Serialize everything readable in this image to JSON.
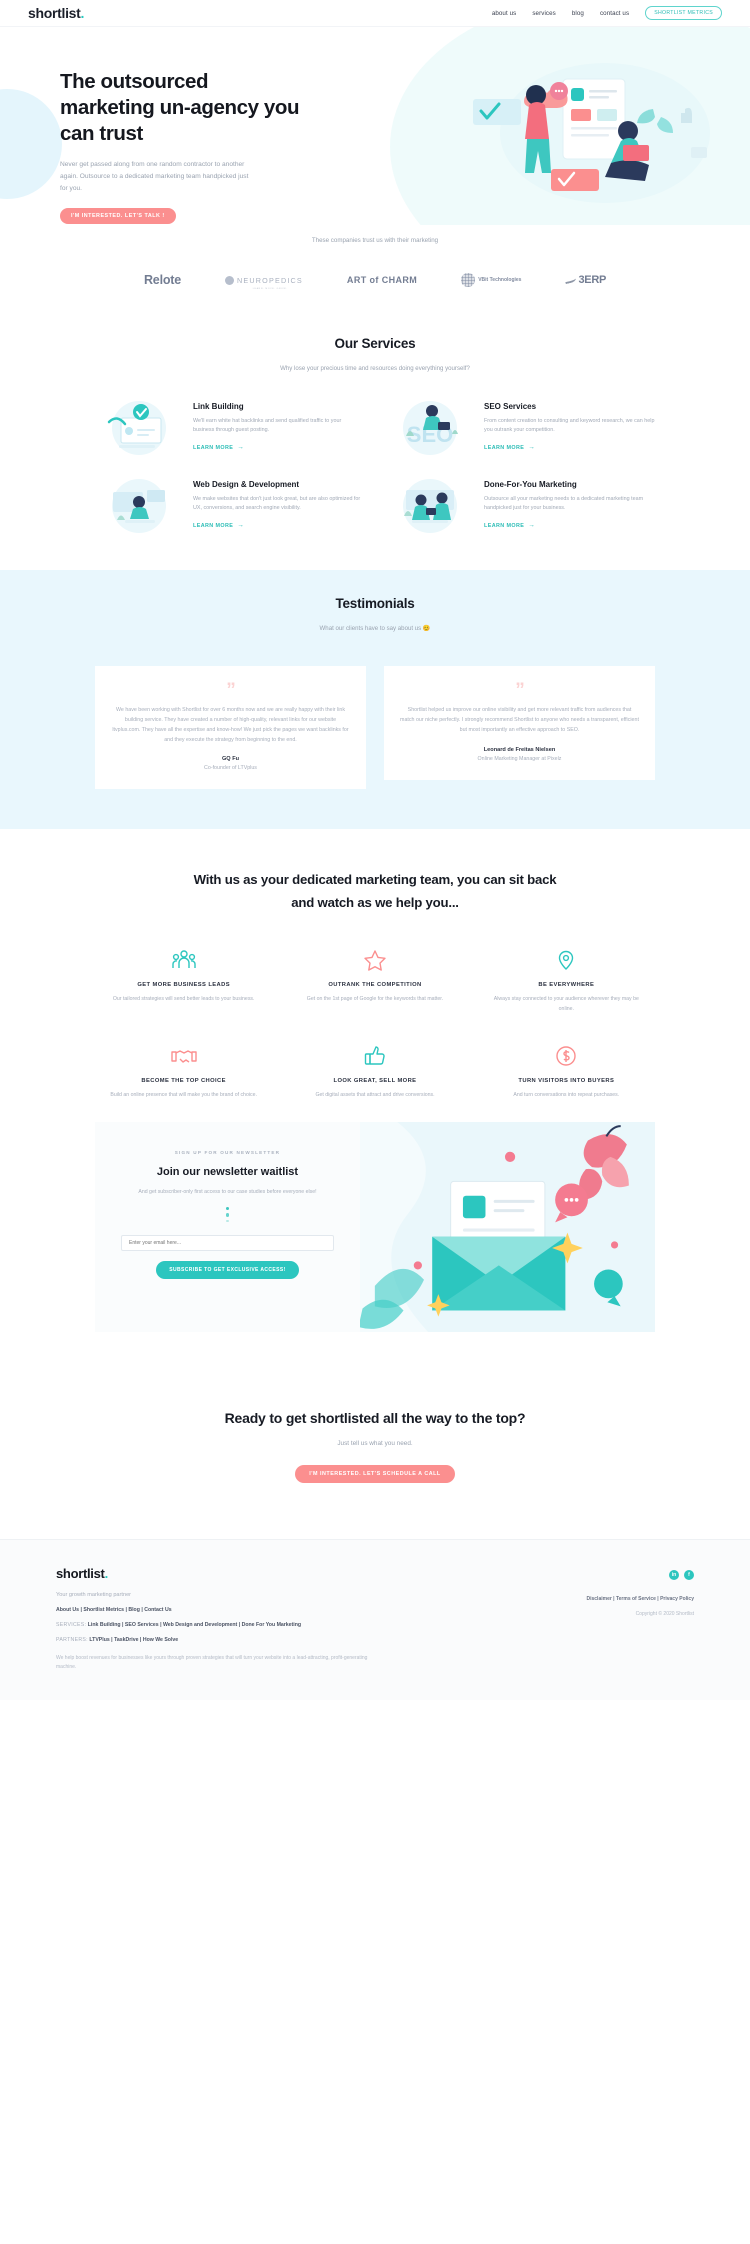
{
  "nav": {
    "logo": "shortlist",
    "logo_dot": ".",
    "links": [
      {
        "label": "about us"
      },
      {
        "label": "services"
      },
      {
        "label": "blog"
      },
      {
        "label": "contact us"
      }
    ],
    "cta_pill": "SHORTLIST METRICS"
  },
  "hero": {
    "heading": "The outsourced marketing un-agency you can trust",
    "paragraph": "Never get passed along from one random contractor to another again. Outsource to a dedicated marketing team handpicked just for you.",
    "button": "I'M INTERESTED. LET'S TALK !"
  },
  "trust": {
    "label": "These companies trust us with their marketing",
    "logos": [
      {
        "name": "Relote"
      },
      {
        "name": "NEUROPEDICS",
        "sub": "LEARN. MOVE. GROW."
      },
      {
        "name": "ART of CHARM"
      },
      {
        "name": "VBit Technologies"
      },
      {
        "name": "3ERP"
      }
    ]
  },
  "services": {
    "title": "Our Services",
    "subtitle": "Why lose your precious time and resources doing everything yourself?",
    "learn_more": "LEARN MORE",
    "items": [
      {
        "title": "Link Building",
        "desc": "We'll earn white hat backlinks and send qualified traffic to your business through guest posting."
      },
      {
        "title": "SEO Services",
        "desc": "From content creation to consulting and keyword research, we can help you outrank your competition."
      },
      {
        "title": "Web Design & Development",
        "desc": "We make websites that don't just look great, but are also optimized for UX, conversions, and search engine visibility."
      },
      {
        "title": "Done-For-You Marketing",
        "desc": "Outsource all your marketing needs to a dedicated marketing team handpicked just for your business."
      }
    ]
  },
  "testimonials": {
    "title": "Testimonials",
    "subtitle": "What our clients have to say about us 😊",
    "items": [
      {
        "quote": "We have been working with Shortlist for over 6 months now and we are really happy with their link building service. They have created a number of high-quality, relevant links for our website ltvplus.com. They have all the expertise and know-how! We just pick the pages we want backlinks for and they execute the strategy from beginning to the end.",
        "name": "GQ Fu",
        "role": "Co-founder of LTVplus"
      },
      {
        "quote": "Shortlist helped us improve our online visibility and get more relevant traffic from audiences that match our niche perfectly. I strongly recommend Shortlist to anyone who needs a transparent, efficient but most importantly an effective approach to SEO.",
        "name": "Leonard de Freitas Nielsen",
        "role": "Online Marketing Manager at Pixelz"
      }
    ]
  },
  "benefits": {
    "heading_line1": "With us as your dedicated marketing team, you can sit back",
    "heading_line2": "and watch as we help you...",
    "items": [
      {
        "icon": "group-people-icon",
        "color": "#2cc6bf",
        "title": "GET MORE BUSINESS LEADS",
        "desc": "Our tailored strategies will send better leads to your business."
      },
      {
        "icon": "star-icon",
        "color": "#fb8f8f",
        "title": "OUTRANK THE COMPETITION",
        "desc": "Get on the 1st page of Google for the keywords that matter."
      },
      {
        "icon": "location-pin-icon",
        "color": "#2cc6bf",
        "title": "BE EVERYWHERE",
        "desc": "Always stay connected to your audience wherever they may be online."
      },
      {
        "icon": "handshake-icon",
        "color": "#fb8f8f",
        "title": "BECOME THE TOP CHOICE",
        "desc": "Build an online presence that will make you the brand of choice."
      },
      {
        "icon": "thumbs-up-icon",
        "color": "#2cc6bf",
        "title": "LOOK GREAT, SELL MORE",
        "desc": "Get digital assets that attract and drive conversions."
      },
      {
        "icon": "dollar-circle-icon",
        "color": "#fb8f8f",
        "title": "TURN VISITORS INTO BUYERS",
        "desc": "And turn conversations into repeat purchases."
      }
    ]
  },
  "newsletter": {
    "kicker": "SIGN UP FOR OUR NEWSLETTER",
    "heading": "Join our newsletter waitlist",
    "paragraph": "And get subscriber-only first access to our case studies before everyone else!",
    "input_placeholder": "Enter your email here...",
    "button": "SUBSCRIBE TO GET EXCLUSIVE ACCESS!"
  },
  "cta": {
    "heading": "Ready to get shortlisted all the way to the top?",
    "subtitle": "Just tell us what you need.",
    "button": "I'M INTERESTED. LET'S SCHEDULE A CALL"
  },
  "footer": {
    "logo": "shortlist",
    "logo_dot": ".",
    "tagline": "Your growth marketing partner",
    "main_links": "About Us | Shortlist Metrics | Blog | Contact Us",
    "services_key": "SERVICES:",
    "services_links": "Link Building | SEO Services | Web Design and Development | Done For You Marketing",
    "partners_key": "PARTNERS:",
    "partners_links": "LTVPlus | TaskDrive | How We Solve",
    "note": "We help boost revenues for businesses like yours through proven strategies that will turn your website into a lead-attracting, profit-generating machine.",
    "legal": "Disclaimer | Terms of Service | Privacy Policy",
    "copyright": "Copyright © 2020 Shortlist",
    "socials": [
      {
        "name": "linkedin-icon",
        "glyph": "in"
      },
      {
        "name": "facebook-icon",
        "glyph": "f"
      }
    ]
  },
  "colors": {
    "teal": "#2cc6bf",
    "pink": "#fb8f8f",
    "light_blue": "#e9f7fd",
    "text_dark": "#171b24",
    "text_muted": "#a7aebb"
  }
}
